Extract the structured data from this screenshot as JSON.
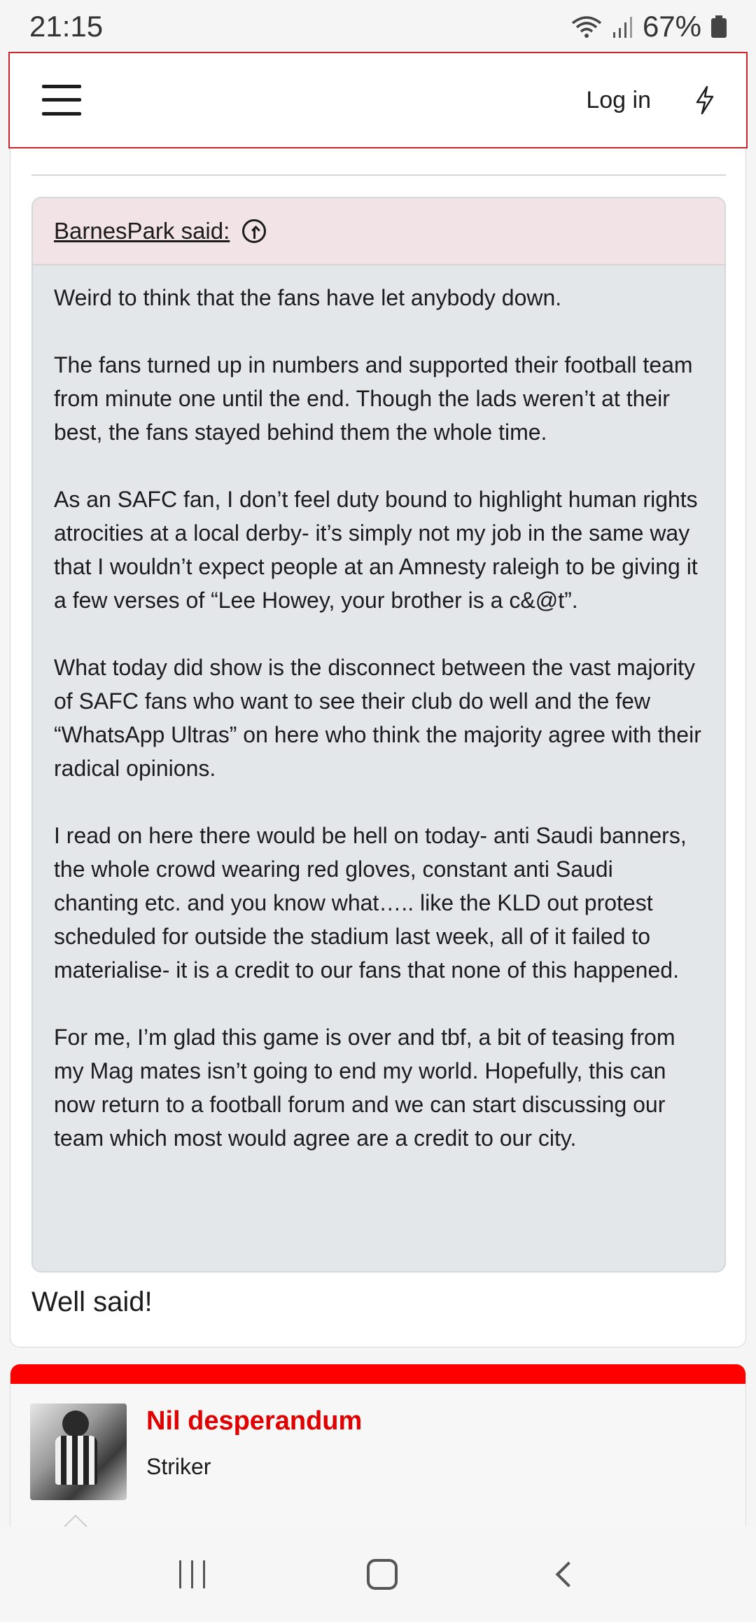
{
  "status_bar": {
    "time": "21:15",
    "battery": "67%",
    "icons": [
      "wifi-icon",
      "signal-icon",
      "battery-icon"
    ]
  },
  "header": {
    "login_label": "Log in",
    "menu_icon": "hamburger-icon",
    "action_icon": "bolt-icon",
    "accent_color": "#c9252c"
  },
  "quote": {
    "author": "BarnesPark said:",
    "paragraphs": [
      "Weird to think that the fans have let anybody down.",
      "The fans turned up in numbers and supported their football team from minute one until the end. Though the lads weren’t at their best, the fans stayed behind them the whole time.",
      "As an SAFC fan, I don’t feel duty bound to highlight human rights atrocities at a local derby- it’s simply not my job in the same way that I wouldn’t expect people at an Amnesty raleigh to be giving it a few verses of “Lee Howey, your brother is a c&@t”.",
      "What today did show is the disconnect between the vast majority of SAFC fans who want to see their club do well and the few “WhatsApp Ultras” on here who think the majority agree with their radical opinions.",
      "I read on here there would be hell on today- anti Saudi banners, the whole crowd wearing red gloves, constant anti Saudi chanting etc. and you know what….. like the KLD out protest scheduled for outside the stadium last week, all of it failed to materialise- it is a credit to our fans that none of this happened.",
      "For me, I’m glad this game is over and tbf, a bit of teasing from my Mag mates isn’t going to end my world. Hopefully, this can now return to a football forum and we can start discussing our team which most would agree are a credit to our city."
    ]
  },
  "reply": {
    "text": "Well said!"
  },
  "next_post": {
    "author": "Nil desperandum",
    "role": "Striker",
    "author_color": "#e00000",
    "bar_color": "#ff0000"
  }
}
